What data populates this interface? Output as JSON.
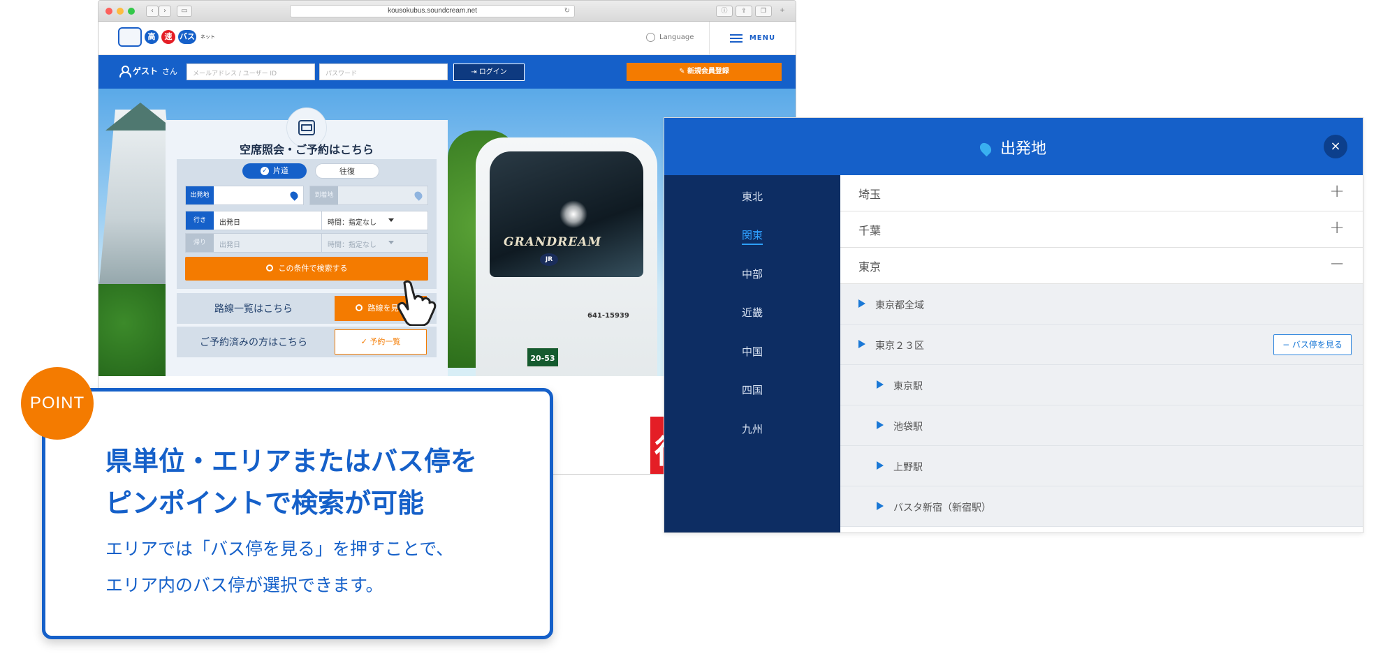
{
  "browser": {
    "url": "kousokubus.soundcream.net"
  },
  "site": {
    "logo_text_1": "高",
    "logo_text_2": "速",
    "logo_text_3": "バス",
    "logo_net": "ネット",
    "language_label": "Language",
    "menu_label": "MENU"
  },
  "login_bar": {
    "guest_label": "ゲスト",
    "guest_suffix": "さん",
    "email_placeholder": "メールアドレス / ユーザー ID",
    "password_placeholder": "パスワード",
    "login_button": "ログイン",
    "register_button": "新規会員登録"
  },
  "search_panel": {
    "title": "空席照会・ご予約はこちら",
    "one_way": "片道",
    "round_trip": "往復",
    "departure_tag": "出発地",
    "arrival_tag": "到着地",
    "outbound_tag": "行き",
    "return_tag": "帰り",
    "date_placeholder": "出発日",
    "time_placeholder": "時間：指定なし",
    "search_button": "この条件で検索する",
    "route_list_label": "路線一覧はこちら",
    "route_list_button": "路線を見る",
    "reserved_label": "ご予約済みの方はこちら",
    "reserved_button": "予約一覧"
  },
  "hero": {
    "bus_brand": "GRANDREAM",
    "bus_logo": "JR",
    "bus_number": "641-15939",
    "plate": "20-53",
    "banner_text": "得割"
  },
  "callout": {
    "badge": "POINT",
    "heading_line1": "県単位・エリアまたはバス停を",
    "heading_line2": "ピンポイントで検索が可能",
    "body_line1": "エリアでは「バス停を見る」を押すことで、",
    "body_line2": "エリア内のバス停が選択できます。"
  },
  "modal": {
    "title": "出発地",
    "close": "×",
    "regions": [
      "東北",
      "関東",
      "中部",
      "近畿",
      "中国",
      "四国",
      "九州"
    ],
    "active_region": "関東",
    "prefectures": [
      {
        "name": "埼玉",
        "sign": "+"
      },
      {
        "name": "千葉",
        "sign": "+"
      },
      {
        "name": "東京",
        "sign": "−"
      }
    ],
    "areas": [
      {
        "name": "東京都全域"
      },
      {
        "name": "東京２３区",
        "button": "− バス停を見る"
      }
    ],
    "stops": [
      "東京駅",
      "池袋駅",
      "上野駅",
      "バスタ新宿（新宿駅）"
    ]
  },
  "colors": {
    "brand_blue": "#1560c9",
    "accent_orange": "#f47b00",
    "region_nav": "#0d2d63"
  }
}
